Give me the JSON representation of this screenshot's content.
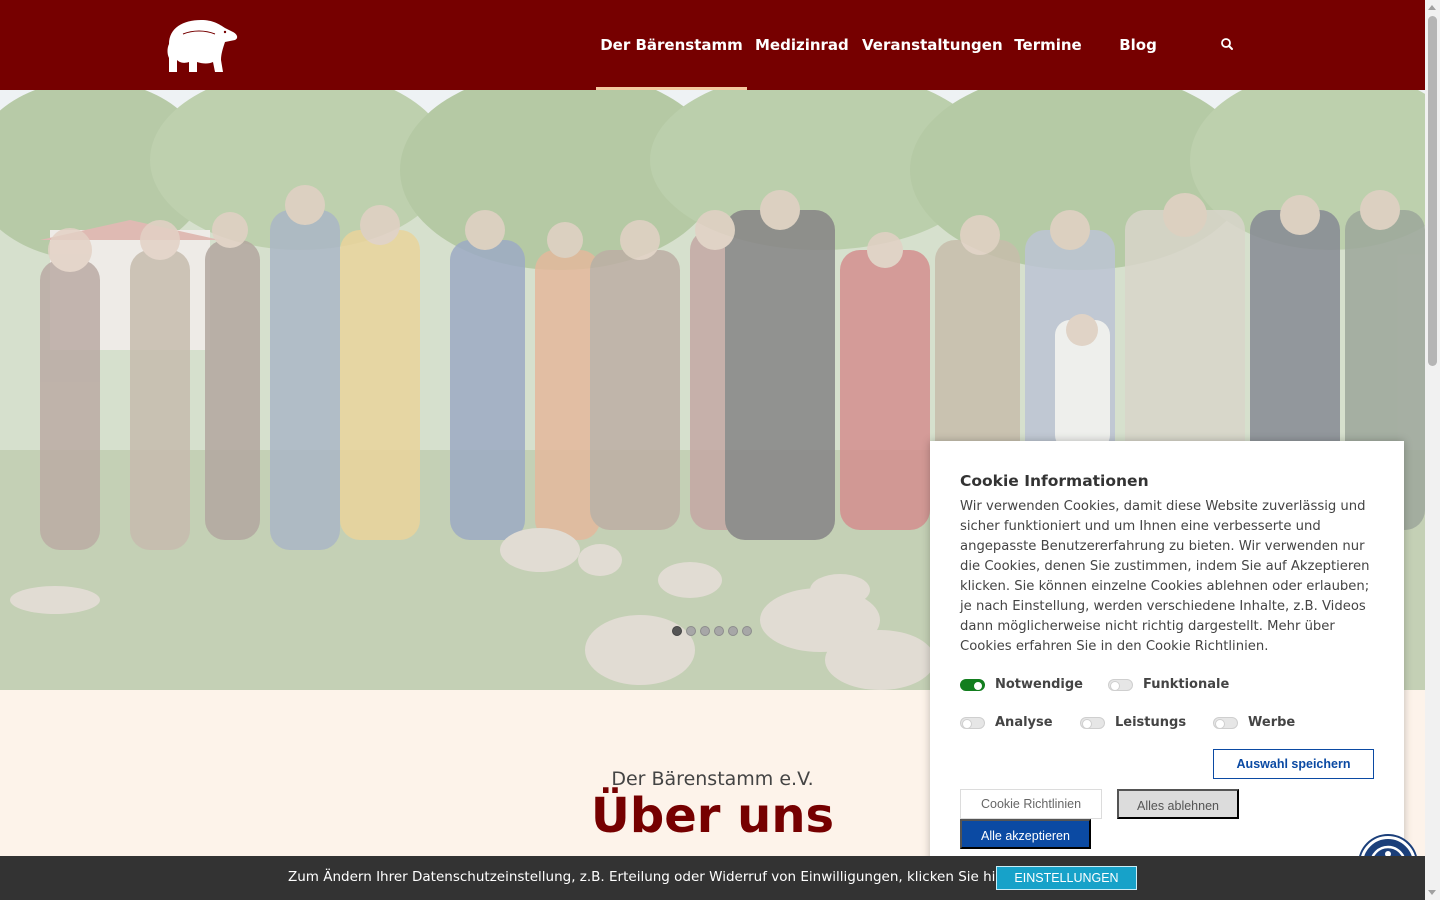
{
  "header": {
    "logo_icon": "polar-bear-icon",
    "nav": [
      {
        "label": "Der Bärenstamm",
        "active": true
      },
      {
        "label": "Medizinrad",
        "active": false
      },
      {
        "label": "Veranstaltungen",
        "active": false
      },
      {
        "label": "Termine",
        "active": false
      },
      {
        "label": "Blog",
        "active": false
      }
    ],
    "search_icon": "search-icon"
  },
  "hero": {
    "slide_count": 6,
    "active_slide": 1
  },
  "section": {
    "subtitle": "Der Bärenstamm e.V.",
    "title": "Über uns"
  },
  "cookie": {
    "title": "Cookie Informationen",
    "text": "Wir verwenden Cookies, damit diese Website zuverlässig und sicher funktioniert und um Ihnen eine verbesserte und angepasste Benutzererfahrung zu bieten. Wir verwenden nur die Cookies, denen Sie zustimmen, indem Sie auf Akzeptieren klicken. Sie können einzelne Cookies ablehnen oder erlauben; je nach Einstellung, werden verschiedene Inhalte, z.B. Videos dann möglicherweise nicht richtig dargestellt. Mehr über Cookies erfahren Sie in den Cookie Richtlinien.",
    "toggles": [
      {
        "label": "Notwendige",
        "on": true
      },
      {
        "label": "Funktionale",
        "on": false
      },
      {
        "label": "Analyse",
        "on": false
      },
      {
        "label": "Leistungs",
        "on": false
      },
      {
        "label": "Werbe",
        "on": false
      }
    ],
    "save_label": "Auswahl speichern",
    "policy_label": "Cookie Richtlinien",
    "reject_label": "Alles ablehnen",
    "accept_label": "Alle akzeptieren"
  },
  "bottom_bar": {
    "text": "Zum Ändern Ihrer Datenschutzeinstellung, z.B. Erteilung oder Widerruf von Einwilligungen, klicken Sie hier:",
    "button_label": "EINSTELLUNGEN"
  },
  "colors": {
    "brand": "#760000",
    "accept": "#0b4aa3",
    "toggle_on": "#137e1f",
    "settings_button": "#17a2c9"
  },
  "accessibility_icon": "accessibility-icon"
}
